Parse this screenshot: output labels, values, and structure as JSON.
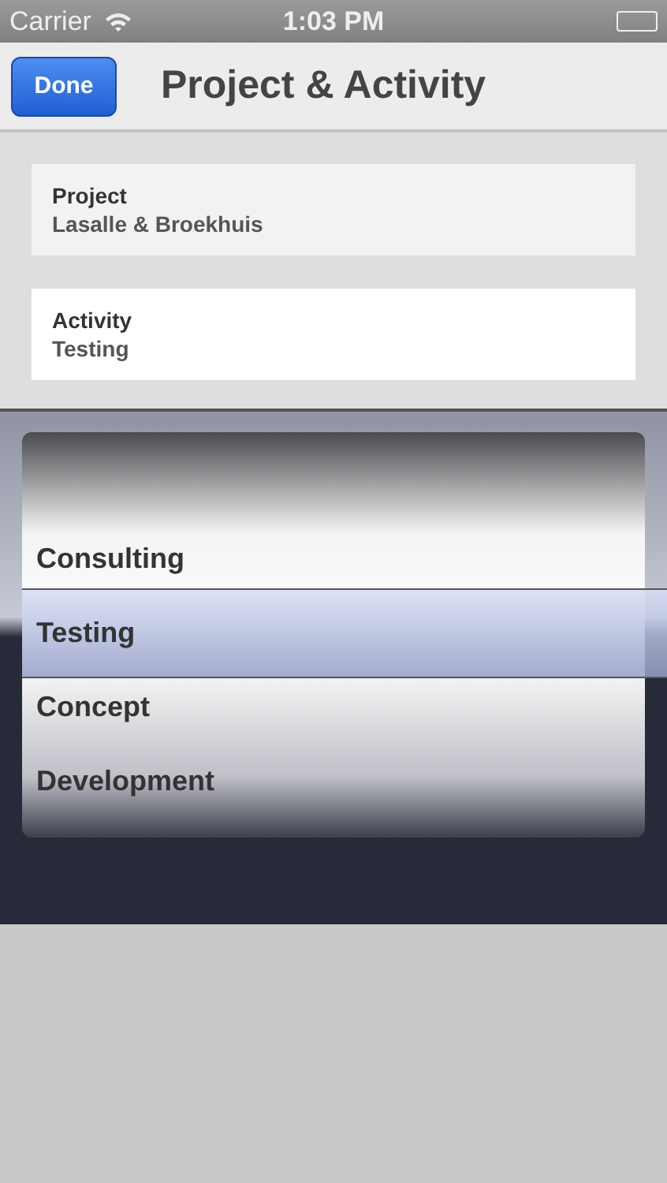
{
  "status_bar": {
    "carrier": "Carrier",
    "time": "1:03 PM"
  },
  "nav_bar": {
    "done_button": "Done",
    "title": "Project & Activity"
  },
  "fields": [
    {
      "label": "Project",
      "value": "Lasalle & Broekhuis",
      "selected": false
    },
    {
      "label": "Activity",
      "value": "Testing",
      "selected": true
    }
  ],
  "picker": {
    "items": [
      {
        "label": "Consulting",
        "selected": false
      },
      {
        "label": "Testing",
        "selected": true
      },
      {
        "label": "Concept",
        "selected": false
      },
      {
        "label": "Development",
        "selected": false
      }
    ]
  }
}
